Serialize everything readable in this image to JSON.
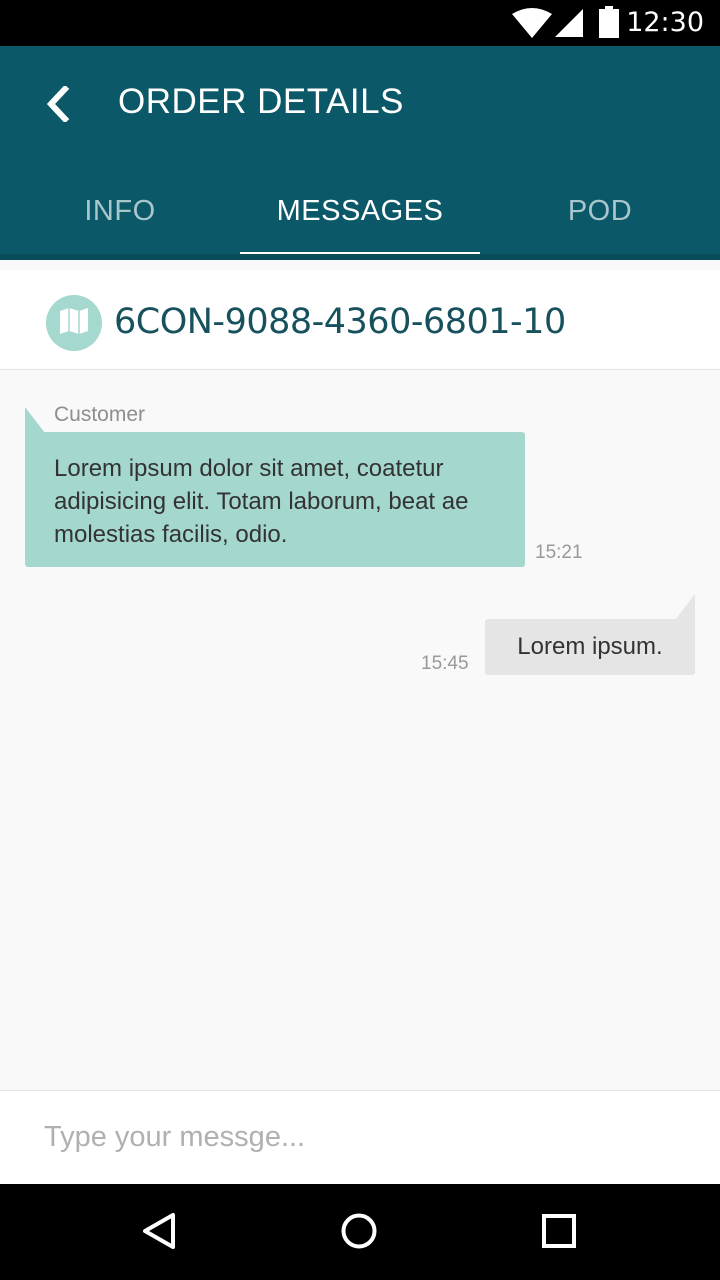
{
  "status_bar": {
    "time": "12:30",
    "icons": [
      "wifi-icon",
      "cell-signal-icon",
      "battery-icon"
    ]
  },
  "header": {
    "title": "ORDER DETAILS",
    "back_icon": "chevron-left-icon"
  },
  "tabs": [
    {
      "label": "INFO",
      "active": false
    },
    {
      "label": "MESSAGES",
      "active": true
    },
    {
      "label": "POD",
      "active": false
    }
  ],
  "order": {
    "icon": "map-icon",
    "number": "6CON-9088-4360-6801-10"
  },
  "messages": [
    {
      "direction": "incoming",
      "sender": "Customer",
      "text": "Lorem ipsum dolor sit amet, coatetur adipisicing elit. Totam laborum, beat ae molestias facilis, odio.",
      "time": "15:21"
    },
    {
      "direction": "outgoing",
      "text": "Lorem ipsum.",
      "time": "15:45"
    }
  ],
  "composer": {
    "placeholder": "Type your messge..."
  },
  "nav_bar": {
    "icons": [
      "back-triangle-icon",
      "home-circle-icon",
      "recents-square-icon"
    ]
  },
  "colors": {
    "primary": "#0b5968",
    "accent": "#a4d7cd",
    "order_text": "#17515e",
    "outgoing_bubble": "#e5e5e5"
  }
}
